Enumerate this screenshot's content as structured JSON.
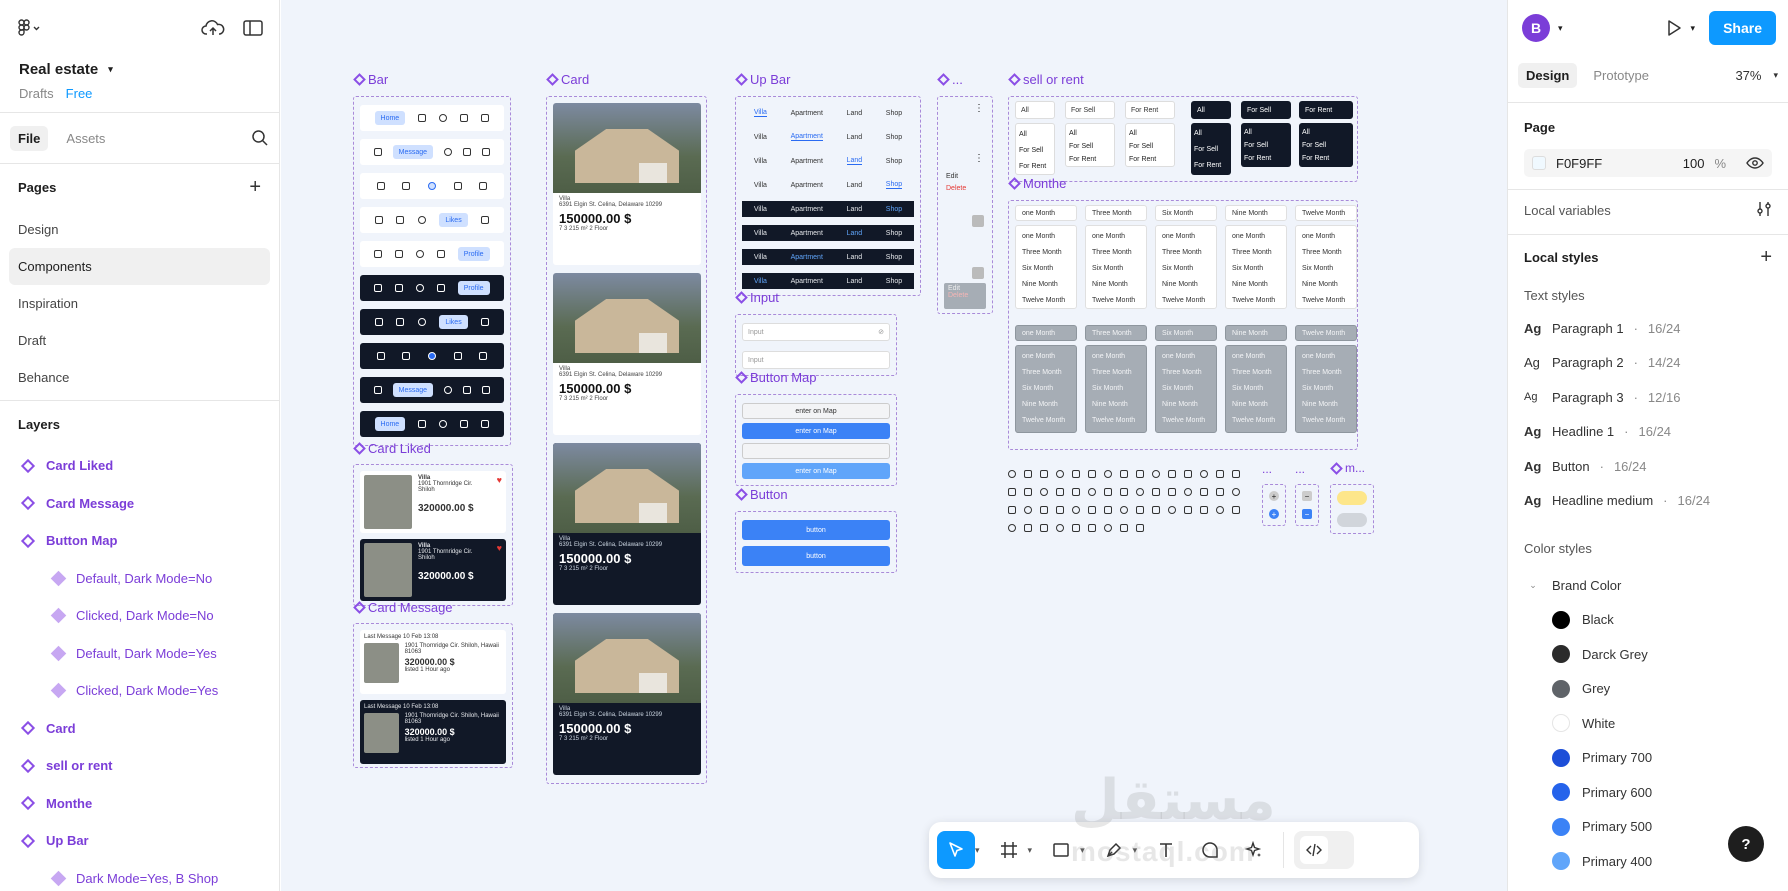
{
  "left_panel": {
    "project_name": "Real estate",
    "drafts_label": "Drafts",
    "plan_label": "Free",
    "tabs": [
      "File",
      "Assets"
    ],
    "pages_title": "Pages",
    "pages": [
      "Design",
      "Components",
      "Inspiration",
      "Draft",
      "Behance"
    ],
    "active_page": "Components",
    "layers_title": "Layers",
    "layers": [
      {
        "label": "Card Liked",
        "kind": "component"
      },
      {
        "label": "Card Message",
        "kind": "component"
      },
      {
        "label": "Button Map",
        "kind": "component"
      },
      {
        "label": "Default, Dark Mode=No",
        "kind": "variant"
      },
      {
        "label": "Clicked, Dark Mode=No",
        "kind": "variant"
      },
      {
        "label": "Default, Dark Mode=Yes",
        "kind": "variant"
      },
      {
        "label": "Clicked, Dark Mode=Yes",
        "kind": "variant"
      },
      {
        "label": "Card",
        "kind": "component"
      },
      {
        "label": "sell or rent",
        "kind": "component"
      },
      {
        "label": "Monthe",
        "kind": "component"
      },
      {
        "label": "Up Bar",
        "kind": "component"
      },
      {
        "label": "Dark Mode=Yes, B Shop",
        "kind": "variant"
      }
    ]
  },
  "canvas": {
    "background": "#F0F4FB",
    "frames": {
      "bar": "Bar",
      "card": "Card",
      "up_bar": "Up Bar",
      "dots": "...",
      "sell_or_rent": "sell or rent",
      "monthe": "Monthe",
      "card_liked": "Card Liked",
      "card_message": "Card Message",
      "input": "Input",
      "button_map": "Button Map",
      "button": "Button",
      "m": "m..."
    },
    "bar_pills": [
      "Home",
      "Message",
      "Likes",
      "Profile",
      "Profile",
      "Likes",
      "Message",
      "Home"
    ],
    "card": {
      "type": "Villa",
      "address": "6391 Elgin St. Celina, Delaware 10299",
      "price": "150000.00 $",
      "badge": "For Sell",
      "agent": "Mohamed Fosta",
      "listed": "listed 1 Hour ago",
      "specs": "7  3  215 m²  2 Floor"
    },
    "card_liked": {
      "type": "Villa",
      "address": "1901 Thornridge Cir. Shiloh",
      "price": "320000.00 $",
      "agent": "Mohamed Fosta"
    },
    "card_message": {
      "title": "Last Message 10 Feb 13:08",
      "address": "1901 Thornridge Cir. Shiloh, Hawaii 81063",
      "price": "320000.00 $",
      "listed": "listed 1 Hour ago"
    },
    "up_bar_items": [
      "Villa",
      "Apartment",
      "Land",
      "Shop"
    ],
    "sell_rent_chips": [
      "All",
      "For Sell",
      "For Rent"
    ],
    "sell_rent_options": [
      "All",
      "For Sell",
      "For Rent"
    ],
    "month_options": [
      "one Month",
      "Three Month",
      "Six Month",
      "Nine Month",
      "Twelve Month"
    ],
    "input_placeholder": "Input",
    "button_map_label": "enter on Map",
    "button_label": "button",
    "dots_menu": {
      "edit": "Edit",
      "delete": "Delete"
    }
  },
  "toolbar": {
    "tools": [
      "move-tool",
      "frame-tool",
      "shape-tool",
      "pen-tool",
      "text-tool",
      "comment-tool",
      "actions-tool",
      "dev-mode-toggle"
    ]
  },
  "watermark": {
    "arabic": "مستقل",
    "latin": "mostaql.com"
  },
  "right_panel": {
    "avatar_letter": "B",
    "share_label": "Share",
    "tabs": [
      "Design",
      "Prototype"
    ],
    "zoom": "37%",
    "page_title": "Page",
    "page_color": "F0F9FF",
    "page_opacity": "100",
    "page_opacity_unit": "%",
    "local_variables": "Local variables",
    "local_styles": "Local styles",
    "text_styles_title": "Text styles",
    "text_styles": [
      {
        "name": "Paragraph 1",
        "size": "16/24"
      },
      {
        "name": "Paragraph 2",
        "size": "14/24"
      },
      {
        "name": "Paragraph 3",
        "size": "12/16"
      },
      {
        "name": "Headline 1",
        "size": "16/24"
      },
      {
        "name": "Button",
        "size": "16/24"
      },
      {
        "name": "Headline medium",
        "size": "16/24"
      }
    ],
    "text_style_glyph": "Ag",
    "text_style_separator": "·",
    "color_styles_title": "Color styles",
    "color_group": "Brand Color",
    "colors": [
      {
        "name": "Black",
        "hex": "#000000"
      },
      {
        "name": "Darck Grey",
        "hex": "#2B2B2B"
      },
      {
        "name": "Grey",
        "hex": "#5F6368"
      },
      {
        "name": "White",
        "hex": "#FFFFFF"
      },
      {
        "name": "Primary 700",
        "hex": "#1D4ED8"
      },
      {
        "name": "Primary 600",
        "hex": "#2563EB"
      },
      {
        "name": "Primary 500",
        "hex": "#3B82F6"
      },
      {
        "name": "Primary 400",
        "hex": "#60A5FA"
      }
    ],
    "help_label": "?"
  }
}
